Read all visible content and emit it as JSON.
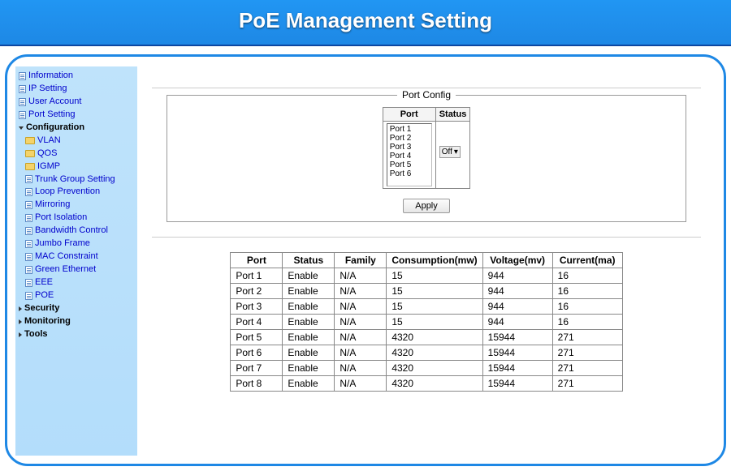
{
  "banner": {
    "title": "PoE Management Setting"
  },
  "sidebar": {
    "items": [
      {
        "type": "page",
        "label": "Information"
      },
      {
        "type": "page",
        "label": "IP Setting"
      },
      {
        "type": "page",
        "label": "User Account"
      },
      {
        "type": "page",
        "label": "Port Setting"
      },
      {
        "type": "section",
        "label": "Configuration"
      },
      {
        "type": "folder",
        "label": "VLAN"
      },
      {
        "type": "folder",
        "label": "QOS"
      },
      {
        "type": "folder",
        "label": "IGMP"
      },
      {
        "type": "page",
        "label": "Trunk Group Setting"
      },
      {
        "type": "page",
        "label": "Loop Prevention"
      },
      {
        "type": "page",
        "label": "Mirroring"
      },
      {
        "type": "page",
        "label": "Port Isolation"
      },
      {
        "type": "page",
        "label": "Bandwidth Control"
      },
      {
        "type": "page",
        "label": "Jumbo Frame"
      },
      {
        "type": "page",
        "label": "MAC Constraint"
      },
      {
        "type": "page",
        "label": "Green Ethernet"
      },
      {
        "type": "page",
        "label": "EEE"
      },
      {
        "type": "page",
        "label": "POE"
      },
      {
        "type": "section",
        "label": "Security"
      },
      {
        "type": "section",
        "label": "Monitoring"
      },
      {
        "type": "section",
        "label": "Tools"
      }
    ]
  },
  "portConfig": {
    "legend": "Port Config",
    "headers": {
      "port": "Port",
      "status": "Status"
    },
    "portOptions": [
      "Port 1",
      "Port 2",
      "Port 3",
      "Port 4",
      "Port 5",
      "Port 6"
    ],
    "statusSelected": "Off",
    "applyLabel": "Apply"
  },
  "statusTable": {
    "headers": [
      "Port",
      "Status",
      "Family",
      "Consumption(mw)",
      "Voltage(mv)",
      "Current(ma)"
    ],
    "rows": [
      {
        "port": "Port 1",
        "status": "Enable",
        "family": "N/A",
        "consumption": "15",
        "voltage": "944",
        "current": "16"
      },
      {
        "port": "Port 2",
        "status": "Enable",
        "family": "N/A",
        "consumption": "15",
        "voltage": "944",
        "current": "16"
      },
      {
        "port": "Port 3",
        "status": "Enable",
        "family": "N/A",
        "consumption": "15",
        "voltage": "944",
        "current": "16"
      },
      {
        "port": "Port 4",
        "status": "Enable",
        "family": "N/A",
        "consumption": "15",
        "voltage": "944",
        "current": "16"
      },
      {
        "port": "Port 5",
        "status": "Enable",
        "family": "N/A",
        "consumption": "4320",
        "voltage": "15944",
        "current": "271"
      },
      {
        "port": "Port 6",
        "status": "Enable",
        "family": "N/A",
        "consumption": "4320",
        "voltage": "15944",
        "current": "271"
      },
      {
        "port": "Port 7",
        "status": "Enable",
        "family": "N/A",
        "consumption": "4320",
        "voltage": "15944",
        "current": "271"
      },
      {
        "port": "Port 8",
        "status": "Enable",
        "family": "N/A",
        "consumption": "4320",
        "voltage": "15944",
        "current": "271"
      }
    ]
  }
}
